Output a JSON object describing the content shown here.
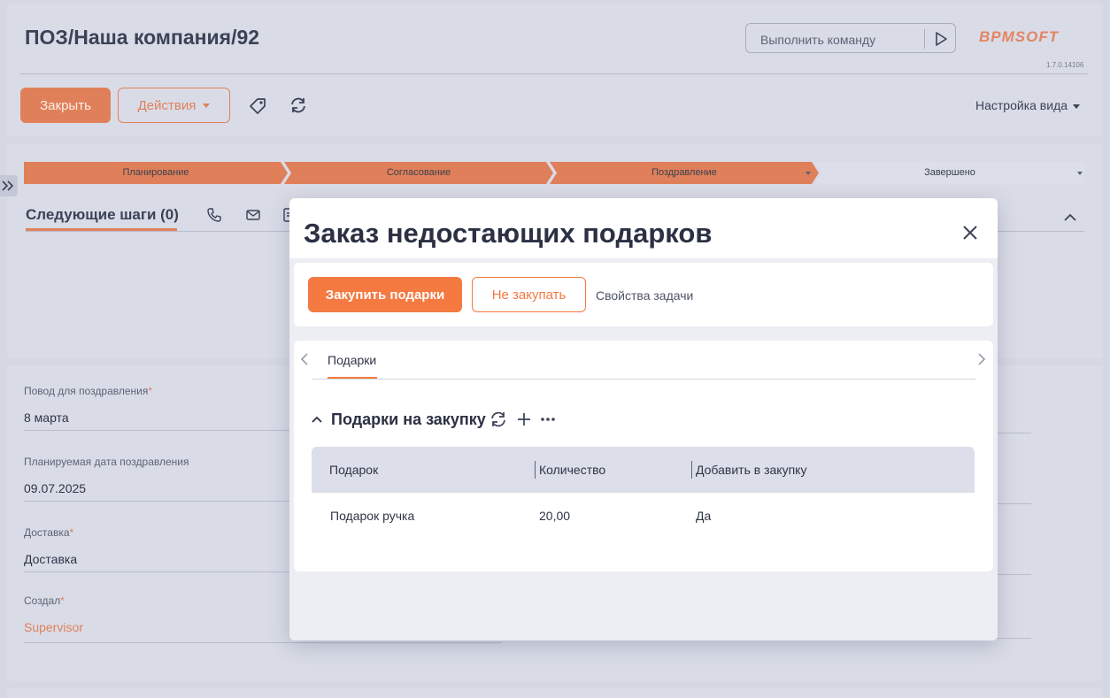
{
  "header": {
    "title": "ПОЗ/Наша компания/92",
    "command_placeholder": "Выполнить команду",
    "logo": "BPMSOFT",
    "version": "1.7.0.14106"
  },
  "toolbar": {
    "close_label": "Закрыть",
    "actions_label": "Действия",
    "view_settings_label": "Настройка вида"
  },
  "stages": [
    {
      "label": "Планирование",
      "state": "done"
    },
    {
      "label": "Согласование",
      "state": "done"
    },
    {
      "label": "Поздравление",
      "state": "current"
    },
    {
      "label": "Завершено",
      "state": "todo"
    }
  ],
  "next_steps": {
    "title": "Следующие шаги (0)"
  },
  "fields": [
    {
      "label": "Повод для поздравления",
      "required": "*",
      "value": "8 марта"
    },
    {
      "label": "Планируемая дата поздравления",
      "required": "",
      "value": "09.07.2025"
    },
    {
      "label": "Доставка",
      "required": "*",
      "value": "Доставка"
    },
    {
      "label": "Создал",
      "required": "*",
      "value": "Supervisor"
    }
  ],
  "modal": {
    "title": "Заказ недостающих подарков",
    "buy_label": "Закупить подарки",
    "no_buy_label": "Не закупать",
    "task_props_label": "Свойства задачи",
    "tab_label": "Подарки",
    "group_title": "Подарки на закупку",
    "columns": [
      "Подарок",
      "Количество",
      "Добавить в закупку"
    ],
    "rows": [
      {
        "gift": "Подарок ручка",
        "qty": "20,00",
        "add": "Да"
      }
    ]
  },
  "colors": {
    "accent": "#f47a42",
    "accent_muted": "#e0805a",
    "background": "#d5d8e3"
  }
}
